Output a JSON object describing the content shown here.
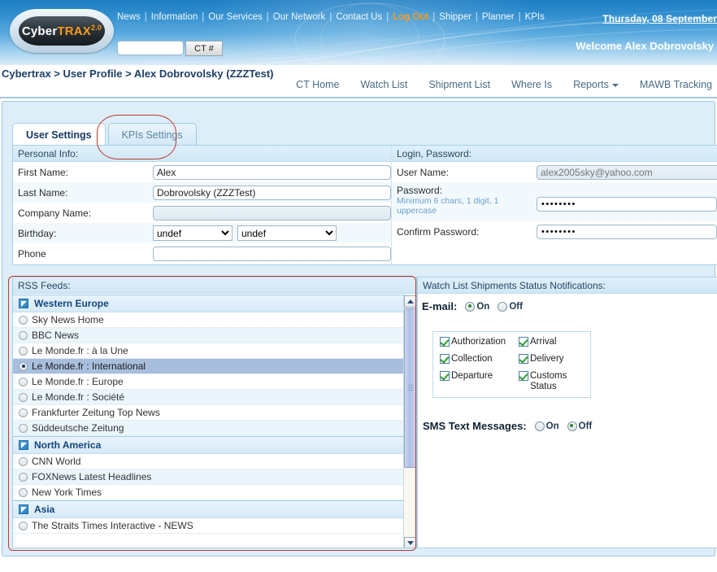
{
  "header": {
    "logo": {
      "part1": "Cyber",
      "part2": "TRAX",
      "version": "2.0"
    },
    "nav": [
      {
        "label": "News"
      },
      {
        "label": "Information"
      },
      {
        "label": "Our Services"
      },
      {
        "label": "Our Network"
      },
      {
        "label": "Contact Us"
      },
      {
        "label": "Log Out",
        "highlight": true
      },
      {
        "label": "Shipper"
      },
      {
        "label": "Planner"
      },
      {
        "label": "KPIs"
      }
    ],
    "separator": "|",
    "search_value": "",
    "search_placeholder": "",
    "ct_button": "CT #",
    "date": "Thursday, 08 September",
    "welcome": "Welcome Alex Dobrovolsky ("
  },
  "breadcrumb": "Cybertrax > User Profile > Alex Dobrovolsky (ZZZTest)",
  "subnav": [
    {
      "label": "CT Home",
      "dropdown": false
    },
    {
      "label": "Watch List",
      "dropdown": false
    },
    {
      "label": "Shipment List",
      "dropdown": false
    },
    {
      "label": "Where Is",
      "dropdown": false
    },
    {
      "label": "Reports",
      "dropdown": true
    },
    {
      "label": "MAWB Tracking",
      "dropdown": false
    }
  ],
  "tabs": [
    {
      "label": "User Settings",
      "active": true
    },
    {
      "label": "KPIs Settings",
      "active": false
    }
  ],
  "personal_info": {
    "section_title": "Personal Info:",
    "first_name_label": "First Name:",
    "first_name_value": "Alex",
    "last_name_label": "Last Name:",
    "last_name_value": "Dobrovolsky (ZZZTest)",
    "company_label": "Company Name:",
    "company_value": "",
    "birthday_label": "Birthday:",
    "birthday_month": "undef",
    "birthday_day": "undef",
    "phone_label": "Phone",
    "phone_value": ""
  },
  "login_password": {
    "section_title": "Login, Password:",
    "user_name_label": "User Name:",
    "user_name_value": "alex2005sky@yahoo.com",
    "password_label": "Password:",
    "password_hint": "Minimum 6 chars, 1 digit, 1 uppercase",
    "password_value": "••••••••",
    "confirm_label": "Confirm Password:",
    "confirm_value": "••••••••"
  },
  "rss": {
    "section_title": "RSS Feeds:",
    "groups": [
      {
        "name": "Western Europe",
        "feeds": [
          {
            "label": "Sky News Home",
            "selected": false
          },
          {
            "label": "BBC News",
            "selected": false
          },
          {
            "label": "Le Monde.fr  : à la Une",
            "selected": false
          },
          {
            "label": "Le Monde.fr  : International",
            "selected": true
          },
          {
            "label": "Le Monde.fr  : Europe",
            "selected": false
          },
          {
            "label": "Le Monde.fr  : Société",
            "selected": false
          },
          {
            "label": "Frankfurter Zeitung Top News",
            "selected": false
          },
          {
            "label": "Süddeutsche Zeitung",
            "selected": false
          }
        ]
      },
      {
        "name": "North America",
        "feeds": [
          {
            "label": "CNN World",
            "selected": false
          },
          {
            "label": "FOXNews Latest Headlines",
            "selected": false
          },
          {
            "label": "New York Times",
            "selected": false
          }
        ]
      },
      {
        "name": "Asia",
        "feeds": [
          {
            "label": "The Straits Times Interactive - NEWS",
            "selected": false
          }
        ]
      }
    ]
  },
  "notifications": {
    "section_title": "Watch List Shipments Status Notifications:",
    "email_label": "E-mail:",
    "email_on": "On",
    "email_off": "Off",
    "email_value": "On",
    "statuses": [
      {
        "label": "Authorization",
        "checked": true
      },
      {
        "label": "Arrival",
        "checked": true
      },
      {
        "label": "Collection",
        "checked": true
      },
      {
        "label": "Delivery",
        "checked": true
      },
      {
        "label": "Departure",
        "checked": true
      },
      {
        "label": "Customs Status",
        "checked": true
      }
    ],
    "sms_label": "SMS Text Messages:",
    "sms_on": "On",
    "sms_off": "Off",
    "sms_value": "Off"
  },
  "colors": {
    "brand_orange": "#f59b1c",
    "header_blue": "#2e8ccd",
    "panel_bg": "#ddeef9",
    "annotation_red": "#c0392b",
    "selected_row": "#a8bedd",
    "check_green": "#2f9e2f"
  }
}
